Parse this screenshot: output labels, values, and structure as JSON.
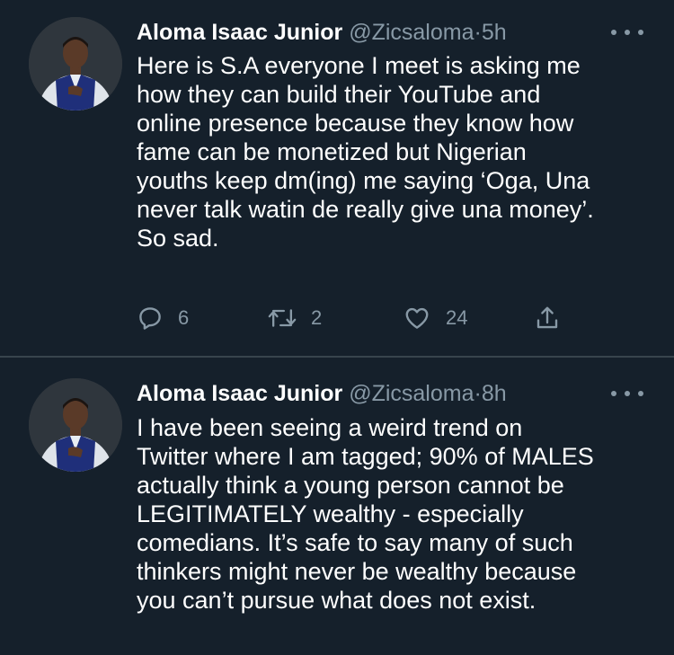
{
  "tweets": [
    {
      "display_name": "Aloma Isaac Junior",
      "handle": "@Zicsaloma",
      "separator": "·",
      "time": "5h",
      "text_lines": [
        "Here is S.A everyone I meet is asking me",
        "how they can build their YouTube and",
        "online presence because they know how",
        "fame can be monetized but Nigerian",
        "youths keep dm(ing) me saying ‘Oga, Una",
        "never talk watin de really give una money’.",
        "So sad."
      ],
      "replies": "6",
      "retweets": "2",
      "likes": "24"
    },
    {
      "display_name": "Aloma Isaac Junior",
      "handle": "@Zicsaloma",
      "separator": "·",
      "time": "8h",
      "text_lines": [
        "I have been seeing a weird trend on",
        "Twitter where I am tagged; 90% of MALES",
        "actually think a young person cannot  be",
        "LEGITIMATELY wealthy - especially",
        "comedians. It’s safe to say many of such",
        "thinkers might never be wealthy because",
        "you can’t pursue what does not exist."
      ]
    }
  ],
  "colors": {
    "background": "#15202b",
    "primary_text": "#ffffff",
    "secondary_text": "#8899a6",
    "divider": "#38444d"
  },
  "icons": [
    "more-icon",
    "reply-icon",
    "retweet-icon",
    "like-icon",
    "share-icon"
  ]
}
